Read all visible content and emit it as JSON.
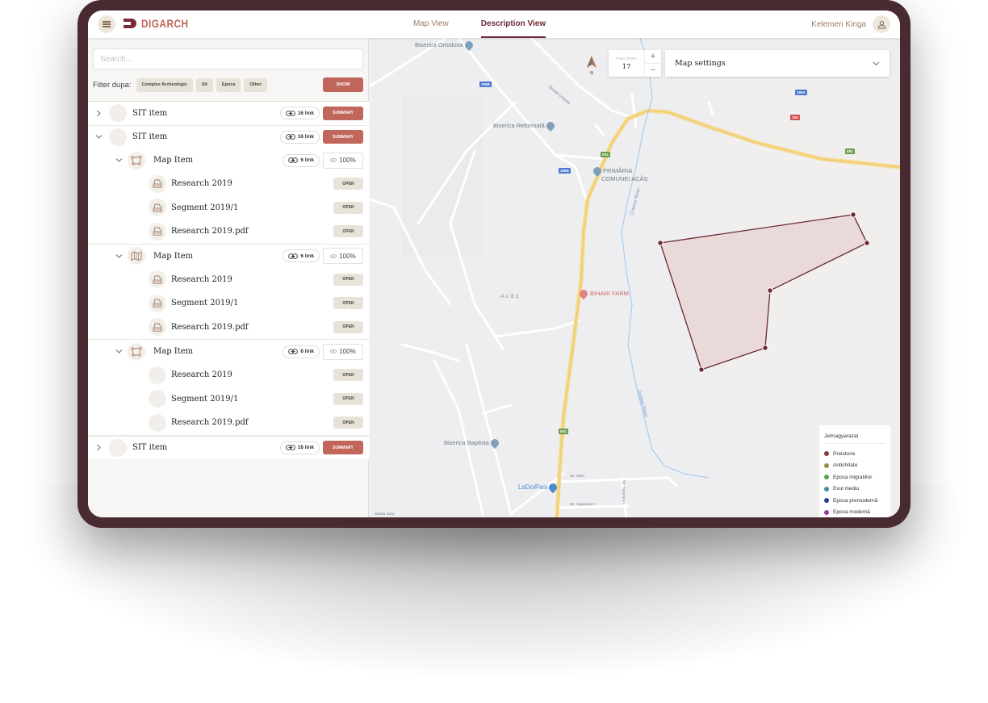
{
  "app": {
    "brand": "DIGARCH",
    "tabs": [
      {
        "label": "Map View",
        "active": false
      },
      {
        "label": "Description View",
        "active": true
      }
    ],
    "user_name": "Kelemen Kinga"
  },
  "sidebar": {
    "search_placeholder": "Search...",
    "filter_label": "Filter dupa:",
    "filters": [
      "Complex Archeologic",
      "Sit",
      "Epoca",
      "Other"
    ],
    "show_label": "SHOW",
    "tree": [
      {
        "label": "SIT item",
        "links": "16 link",
        "action": "SUMMARY",
        "expanded": false
      },
      {
        "label": "SIT item",
        "links": "16 link",
        "action": "SUMMARY",
        "expanded": true,
        "children": [
          {
            "label": "Map Item",
            "icon": "polygon-icon",
            "links": "6 link",
            "visibility": "100%",
            "children": [
              {
                "label": "Research 2019",
                "action": "OPEN",
                "icon": "document-stack-icon"
              },
              {
                "label": "Segment 2019/1",
                "action": "OPEN",
                "icon": "document-stack-icon"
              },
              {
                "label": "Research 2019.pdf",
                "action": "OPEN",
                "icon": "document-stack-icon"
              }
            ]
          },
          {
            "label": "Map Item",
            "icon": "map-folded-icon",
            "links": "6 link",
            "visibility": "100%",
            "children": [
              {
                "label": "Research 2019",
                "action": "OPEN",
                "icon": "document-stack-icon"
              },
              {
                "label": "Segment 2019/1",
                "action": "OPEN",
                "icon": "document-stack-icon"
              },
              {
                "label": "Research 2019.pdf",
                "action": "OPEN",
                "icon": "document-stack-icon"
              }
            ]
          },
          {
            "label": "Map Item",
            "icon": "polygon-icon",
            "links": "6 link",
            "visibility": "100%",
            "children": [
              {
                "label": "Research 2019",
                "action": "OPEN",
                "icon": ""
              },
              {
                "label": "Segment 2019/1",
                "action": "OPEN",
                "icon": ""
              },
              {
                "label": "Research 2019.pdf",
                "action": "OPEN",
                "icon": ""
              }
            ]
          }
        ]
      },
      {
        "label": "SIT item",
        "links": "16 link",
        "action": "SUMMARY",
        "expanded": false
      }
    ]
  },
  "map": {
    "zoom_caption": "map zoom",
    "zoom_level": "17",
    "zoom_in": "+",
    "zoom_out": "−",
    "compass_label": "N",
    "settings_label": "Map settings",
    "labels": {
      "biserica_ortodoxa": "Biserica Ortodoxa",
      "biserica_reformata": "Biserica Reformată",
      "primaria_1": "PRIMĂRIA",
      "primaria_2": "COMUNEI ACĂȘ",
      "acas": "A c ă ș",
      "bihari": "BIHARI FARM",
      "biserica_baptista": "Biserica Baptista",
      "ladoipasi": "LaDoiPasi",
      "strada_crasnei": "Strada Crasnei",
      "crasna_river_1": "Crasna River",
      "crasna_river_2": "Crasna River",
      "str_morii": "Str. Morii",
      "str_suparului_1": "Str. Suparului I",
      "str_suparului_2": "Str. Suparului II",
      "strada_gara": "Strada Gara"
    },
    "road_badges": {
      "r195b_1": "195B",
      "r195b_2": "195B",
      "r195a": "195A",
      "r19a": "19A",
      "e81_1": "E81",
      "e81_2": "E81",
      "e81_3": "E81"
    },
    "legend": {
      "title": "Jelmagyarazat",
      "items": [
        {
          "label": "Preistorie",
          "color": "#8b3a3a"
        },
        {
          "label": "Antichitate",
          "color": "#9e8a4a"
        },
        {
          "label": "Epoca migratiilor",
          "color": "#5aa04a"
        },
        {
          "label": "Evul mediu",
          "color": "#4a8ab0"
        },
        {
          "label": "Epoca premodernă",
          "color": "#2a3a9a"
        },
        {
          "label": "Epoca modernă",
          "color": "#9a3aa0"
        }
      ]
    },
    "polygon": {
      "fill": "#e8d5d5",
      "stroke": "#6b2a33",
      "vertices": 6
    }
  },
  "colors": {
    "accent": "#c0665a",
    "brand_dark": "#6b2a33",
    "tab_inactive": "#a17c62",
    "chip_bg": "#e7e3d9",
    "device_frame": "#4a2a31"
  }
}
